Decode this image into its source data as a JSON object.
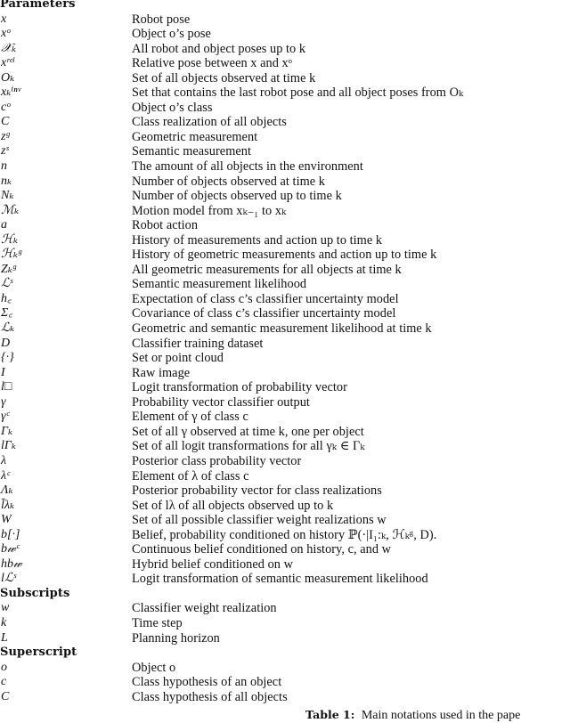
{
  "table": {
    "sections": [
      {
        "heading": "Parameters",
        "rows": [
          {
            "symbol": "x",
            "description": "Robot pose"
          },
          {
            "symbol": "xᵒ",
            "description": "Object o’s pose"
          },
          {
            "symbol": "𝒳ₖ",
            "description": "All robot and object poses up to k"
          },
          {
            "symbol": "xʳᵉˡ",
            "description": "Relative pose between x and xᵒ"
          },
          {
            "symbol": "Oₖ",
            "description": "Set of all objects observed at time k"
          },
          {
            "symbol": "xₖⁱⁿᵛ",
            "description": "Set that contains the last robot pose and all object poses from Oₖ"
          },
          {
            "symbol": "cᵒ",
            "description": "Object o’s class"
          },
          {
            "symbol": "C",
            "description": "Class realization of all objects"
          },
          {
            "symbol": "zᵍ",
            "description": "Geometric measurement"
          },
          {
            "symbol": "zˢ",
            "description": "Semantic measurement"
          },
          {
            "symbol": "n",
            "description": "The amount of all objects in the environment"
          },
          {
            "symbol": "nₖ",
            "description": "Number of objects observed at time k"
          },
          {
            "symbol": "Nₖ",
            "description": "Number of objects observed up to time k"
          },
          {
            "symbol": "ℳₖ",
            "description": "Motion model from xₖ₋₁ to xₖ"
          },
          {
            "symbol": "a",
            "description": "Robot action"
          },
          {
            "symbol": "ℋₖ",
            "description": "History of measurements and action up to time k"
          },
          {
            "symbol": "ℋₖᵍ",
            "description": "History of geometric measurements and action up to time k"
          },
          {
            "symbol": "Zₖᵍ",
            "description": "All geometric measurements for all objects at time k"
          },
          {
            "symbol": "ℒˢ",
            "description": "Semantic measurement likelihood"
          },
          {
            "symbol": "h꜀",
            "description": "Expectation of class c’s classifier uncertainty model"
          },
          {
            "symbol": "Σ꜀",
            "description": "Covariance of class c’s classifier uncertainty model"
          },
          {
            "symbol": "ℒₖ",
            "description": "Geometric and semantic measurement likelihood at time k"
          },
          {
            "symbol": "D",
            "description": "Classifier training dataset"
          },
          {
            "symbol": "{·}",
            "description": "Set or point cloud"
          },
          {
            "symbol": "I",
            "description": "Raw image"
          },
          {
            "symbol": "l□",
            "description": "Logit transformation of probability vector"
          },
          {
            "symbol": "γ",
            "description": "Probability vector classifier output"
          },
          {
            "symbol": "γᶜ",
            "description": "Element of γ of class c"
          },
          {
            "symbol": "Γₖ",
            "description": "Set of all γ observed at time k, one per object"
          },
          {
            "symbol": "lΓₖ",
            "description": "Set of all logit transformations for all γₖ ∈ Γₖ"
          },
          {
            "symbol": "λ",
            "description": "Posterior class probability vector"
          },
          {
            "symbol": "λᶜ",
            "description": "Element of λ of class c"
          },
          {
            "symbol": "Λₖ",
            "description": "Posterior probability vector for class realizations"
          },
          {
            "symbol": "l̄λₖ",
            "description": "Set of lλ of all objects observed up to k"
          },
          {
            "symbol": "W",
            "description": "Set of all possible classifier weight realizations w"
          },
          {
            "symbol": "b[·]",
            "description": "Belief, probability conditioned on history ℙ(·|I₁:ₖ, ℋₖᵍ, D)."
          },
          {
            "symbol": "b𝓌ᶜ",
            "description": "Continuous belief conditioned on history, c, and w"
          },
          {
            "symbol": "hb𝓌",
            "description": "Hybrid belief conditioned on w"
          },
          {
            "symbol": "lℒˢ",
            "description": "Logit transformation of semantic measurement likelihood"
          }
        ]
      },
      {
        "heading": "Subscripts",
        "rows": [
          {
            "symbol": "w",
            "description": "Classifier weight realization"
          },
          {
            "symbol": "k",
            "description": "Time step"
          },
          {
            "symbol": "L",
            "description": "Planning horizon"
          }
        ]
      },
      {
        "heading": "Superscript",
        "rows": [
          {
            "symbol": "o",
            "description": "Object o"
          },
          {
            "symbol": "c",
            "description": "Class hypothesis of an object"
          },
          {
            "symbol": "C",
            "description": "Class hypothesis of all objects"
          }
        ]
      }
    ]
  },
  "caption": {
    "label": "Table 1:",
    "text": "Main notations used in the pape"
  }
}
